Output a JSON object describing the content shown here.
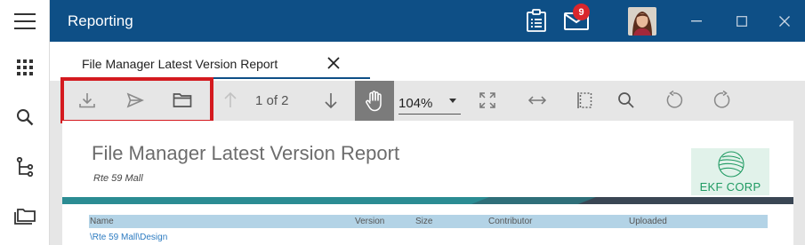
{
  "app": {
    "title": "Reporting"
  },
  "header": {
    "mail_count": "9"
  },
  "tab": {
    "label": "File Manager Latest Version Report"
  },
  "toolbar": {
    "page_indicator": "1 of 2",
    "zoom": "104%"
  },
  "report": {
    "title": "File Manager Latest Version Report",
    "subtitle": "Rte 59 Mall",
    "logo_text": "EKF CORP",
    "columns": [
      "Name",
      "Version",
      "Size",
      "Contributor",
      "Uploaded"
    ],
    "first_row_path": "\\Rte 59 Mall\\Design"
  },
  "colors": {
    "header_bg": "#0e4f86",
    "highlight": "#d41a1f",
    "badge": "#d9262c",
    "table_header": "#b3d3e6",
    "link": "#2c7bc1",
    "logo_green": "#1f9a62"
  },
  "icons": [
    "hamburger-menu-icon",
    "apps-grid-icon",
    "search-icon",
    "tree-icon",
    "folders-icon",
    "clipboard-icon",
    "mail-icon",
    "download-icon",
    "send-icon",
    "folder-icon",
    "arrow-up-icon",
    "arrow-down-icon",
    "hand-pan-icon",
    "fit-page-icon",
    "fit-width-icon",
    "select-area-icon",
    "find-icon",
    "rotate-left-icon",
    "rotate-right-icon"
  ]
}
